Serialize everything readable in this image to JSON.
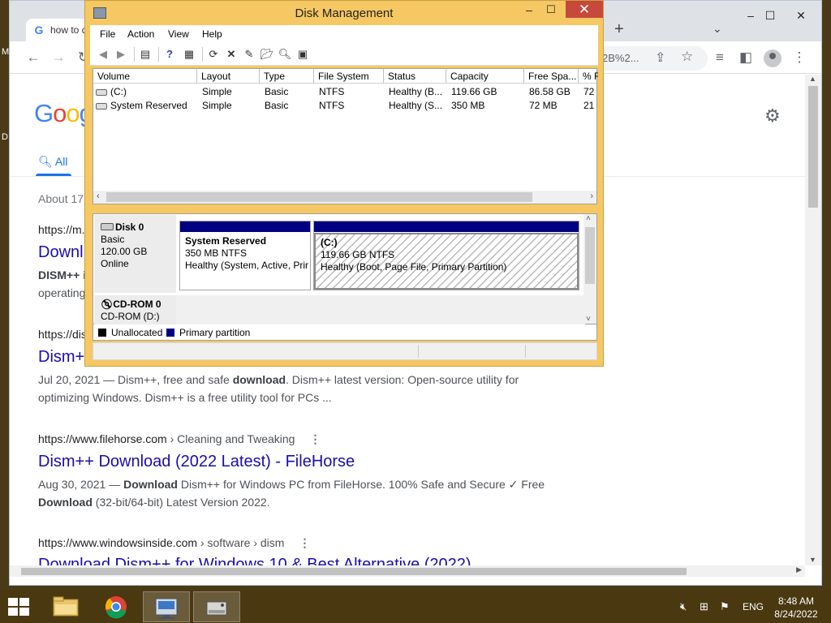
{
  "desktop": {
    "left_glyph_top": "M",
    "left_glyph_mid": "D"
  },
  "chrome": {
    "tab_title": "how to d",
    "favicon": "G",
    "new_tab": "+",
    "tab_search": "⌄",
    "win_min": "–",
    "win_max": "☐",
    "win_close": "✕",
    "omnibox_visible_text": "2B%2...",
    "google_logo": [
      "G",
      "o",
      "o",
      "g"
    ],
    "search_tab_all": "All",
    "about_text": "About 17",
    "results": [
      {
        "cite": "https://m.",
        "cite_path": "",
        "title": "Downl",
        "snippet_html": "<b>DISM++ i</b><br>operating"
      },
      {
        "cite": "https://dis",
        "cite_path": "",
        "title": "Dism+",
        "snippet_html": "Jul 20, 2021 — Dism++, free and safe <b>download</b>. Dism++ latest version: Open-source utility for optimizing Windows. Dism++ is a free utility tool for PCs ..."
      },
      {
        "cite": "https://www.filehorse.com",
        "cite_path": " › Cleaning and Tweaking",
        "title": "Dism++ Download (2022 Latest) - FileHorse",
        "snippet_html": "Aug 30, 2021 — <b>Download</b> Dism++ for Windows PC from FileHorse. 100% Safe and Secure ✓ Free <b>Download</b> (32-bit/64-bit) Latest Version 2022."
      },
      {
        "cite": "https://www.windowsinside.com",
        "cite_path": " › software › dism",
        "title": "Download Dism++ for Windows 10 & Best Alternative (2022)",
        "snippet_html": ""
      }
    ]
  },
  "disk_management": {
    "title": "Disk Management",
    "close_glyph": "✕",
    "min_glyph": "–",
    "max_glyph": "☐",
    "menu": [
      "File",
      "Action",
      "View",
      "Help"
    ],
    "columns": [
      "Volume",
      "Layout",
      "Type",
      "File System",
      "Status",
      "Capacity",
      "Free Spa...",
      "% F"
    ],
    "rows": [
      [
        "(C:)",
        "Simple",
        "Basic",
        "NTFS",
        "Healthy (B...",
        "119.66 GB",
        "86.58 GB",
        "72"
      ],
      [
        "System Reserved",
        "Simple",
        "Basic",
        "NTFS",
        "Healthy (S...",
        "350 MB",
        "72 MB",
        "21"
      ]
    ],
    "disks": [
      {
        "name": "Disk 0",
        "lines": [
          "Basic",
          "120.00 GB",
          "Online"
        ],
        "partitions": [
          {
            "name": "System Reserved",
            "line1": "350 MB NTFS",
            "line2": "Healthy (System, Active, Prir"
          },
          {
            "name": "(C:)",
            "line1": "119.66 GB NTFS",
            "line2": "Healthy (Boot, Page File, Primary Partition)"
          }
        ]
      },
      {
        "name": "CD-ROM 0",
        "lines": [
          "CD-ROM (D:)"
        ]
      }
    ],
    "legend": [
      {
        "label": "Unallocated",
        "color": "#000000"
      },
      {
        "label": "Primary partition",
        "color": "#000080"
      }
    ]
  },
  "taskbar": {
    "lang": "ENG",
    "time": "8:48 AM",
    "date": "8/24/2022"
  },
  "colors": {
    "dm_frame": "#f6c863",
    "close_red": "#c7493b",
    "partition_bar": "#000080",
    "link_blue": "#1a0dab",
    "taskbar": "#4a3810"
  }
}
